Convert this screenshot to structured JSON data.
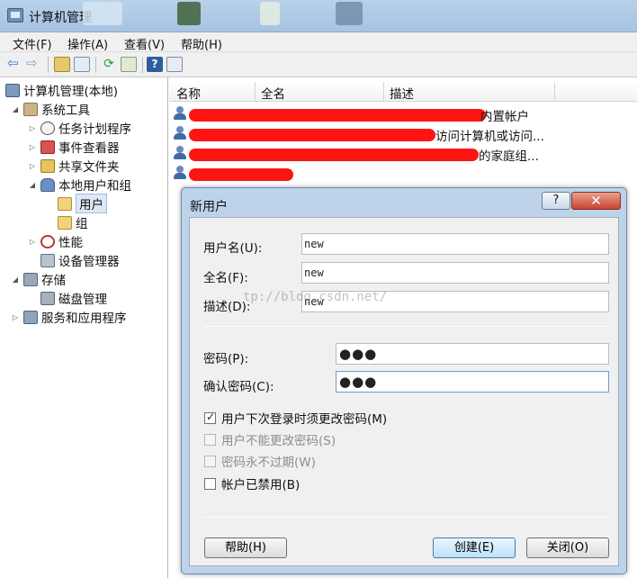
{
  "window": {
    "title": "计算机管理"
  },
  "menu": [
    "文件(F)",
    "操作(A)",
    "查看(V)",
    "帮助(H)"
  ],
  "tree": [
    {
      "label": "计算机管理(本地)",
      "icon": "computer-management-icon",
      "level": 0,
      "arrow": ""
    },
    {
      "label": "系统工具",
      "icon": "system-tools-icon",
      "level": 1,
      "arrow": "◢"
    },
    {
      "label": "任务计划程序",
      "icon": "clock-icon",
      "level": 2,
      "arrow": "▷"
    },
    {
      "label": "事件查看器",
      "icon": "event-viewer-icon",
      "level": 2,
      "arrow": "▷"
    },
    {
      "label": "共享文件夹",
      "icon": "shared-folder-icon",
      "level": 2,
      "arrow": "▷"
    },
    {
      "label": "本地用户和组",
      "icon": "users-groups-icon",
      "level": 2,
      "arrow": "◢"
    },
    {
      "label": "用户",
      "icon": "folder-icon",
      "level": 3,
      "arrow": "",
      "selected": true
    },
    {
      "label": "组",
      "icon": "folder-icon",
      "level": 3,
      "arrow": ""
    },
    {
      "label": "性能",
      "icon": "performance-icon",
      "level": 2,
      "arrow": "▷"
    },
    {
      "label": "设备管理器",
      "icon": "device-manager-icon",
      "level": 2,
      "arrow": ""
    },
    {
      "label": "存储",
      "icon": "storage-icon",
      "level": 1,
      "arrow": "◢"
    },
    {
      "label": "磁盘管理",
      "icon": "disk-icon",
      "level": 2,
      "arrow": ""
    },
    {
      "label": "服务和应用程序",
      "icon": "services-icon",
      "level": 1,
      "arrow": "▷"
    }
  ],
  "list": {
    "columns": [
      "名称",
      "全名",
      "描述"
    ],
    "rows": [
      {
        "desc_tail": "内置帐户"
      },
      {
        "desc_tail": "访问计算机或访问..."
      },
      {
        "desc_tail": "的家庭组..."
      },
      {
        "desc_tail": ""
      }
    ]
  },
  "dialog": {
    "title": "新用户",
    "help_glyph": "?",
    "close_glyph": "✕",
    "username_label": "用户名(U):",
    "username_value": "new",
    "fullname_label": "全名(F):",
    "fullname_value": "new",
    "description_label": "描述(D):",
    "description_value": "new",
    "password_label": "密码(P):",
    "password_value": "●●●",
    "confirm_label": "确认密码(C):",
    "confirm_value": "●●●",
    "options": [
      {
        "label": "用户下次登录时须更改密码(M)",
        "checked": true,
        "disabled": false
      },
      {
        "label": "用户不能更改密码(S)",
        "checked": false,
        "disabled": true
      },
      {
        "label": "密码永不过期(W)",
        "checked": false,
        "disabled": true
      },
      {
        "label": "帐户已禁用(B)",
        "checked": false,
        "disabled": false
      }
    ],
    "help_button": "帮助(H)",
    "create_button": "创建(E)",
    "close_button": "关闭(O)"
  },
  "watermark": "tp://blog.csdn.net/"
}
